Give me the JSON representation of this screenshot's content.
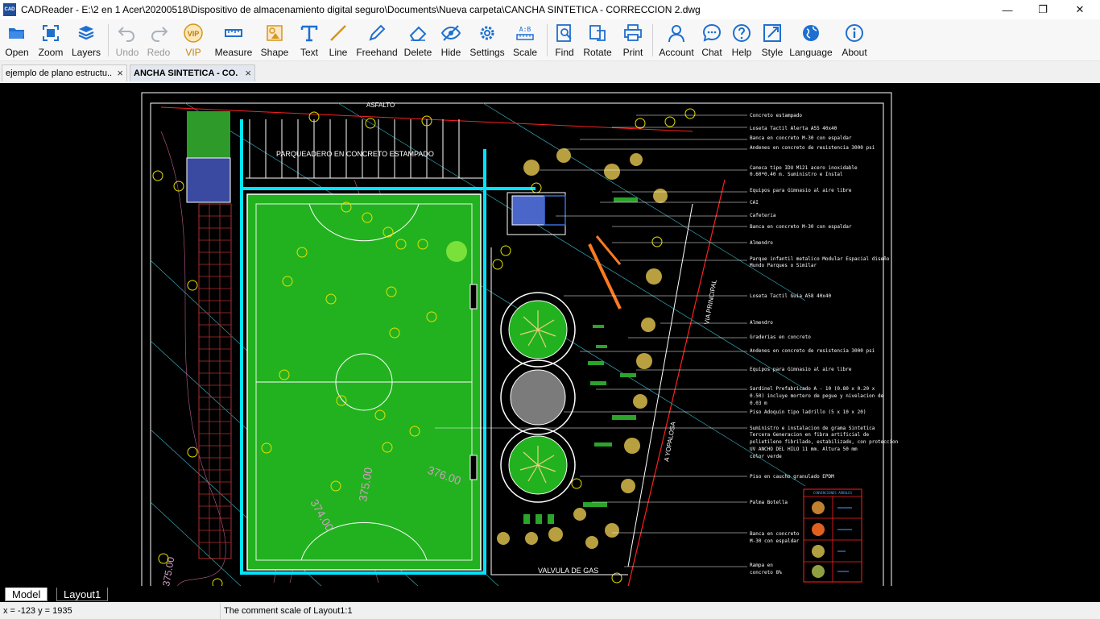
{
  "window": {
    "title": "CADReader - E:\\2 en 1 Acer\\20200518\\Dispositivo de almacenamiento digital seguro\\Documents\\Nueva carpeta\\CANCHA SINTETICA - CORRECCION 2.dwg",
    "app_icon_text": "CAD",
    "minimize": "—",
    "maximize": "❐",
    "close": "✕"
  },
  "toolbar": {
    "open": "Open",
    "zoom": "Zoom",
    "layers": "Layers",
    "undo": "Undo",
    "redo": "Redo",
    "vip": "VIP",
    "measure": "Measure",
    "shape": "Shape",
    "text": "Text",
    "line": "Line",
    "freehand": "Freehand",
    "delete": "Delete",
    "hide": "Hide",
    "settings": "Settings",
    "scale": "Scale",
    "find": "Find",
    "rotate": "Rotate",
    "print": "Print",
    "account": "Account",
    "chat": "Chat",
    "help": "Help",
    "style": "Style",
    "language": "Language",
    "about": "About"
  },
  "tabs": [
    {
      "label": "ejemplo de plano estructu..",
      "close": "×"
    },
    {
      "label": "ANCHA SINTETICA - CO.",
      "close": "×"
    }
  ],
  "drawing": {
    "parking_label": "PARQUEADERO EN CONCRETO ESTAMPADO",
    "top_label": "ASFALTO",
    "contour_376": "376.00",
    "contour_375": "375.00",
    "contour_374": "374.00",
    "contour_375_bl": "375.00",
    "via_principal": "VIA PRINCIPAL",
    "yopalosa": "A YOPALOSA",
    "valvula": "VALVULA DE GAS",
    "legend": [
      "Concreto estampado",
      "Loseta Tactil Alerta A55 40x40",
      "Banca en concreto M-30 con espaldar",
      "Andenes en concreto de resistencia 3000 psi",
      "Caneca tipo IDU M121 acero inoxidable",
      "0.60*0.40 m. Suministro e Instal",
      "Equipos para Gimnasio al aire libre",
      "CAI",
      "Cafeteria",
      "Banca en concreto M-30 con espaldar",
      "Almendro",
      "Parque infantil metalico Modular Espacial diseño",
      "Mundo Parques o Similar",
      "Loseta Tactil Guia A58 40x40",
      "Almendro",
      "Graderias en concreto",
      "Andenes en concreto de resistencia 3000 psi",
      "Equipos para Gimnasio al aire libre",
      "Sardinel Prefabricado A - 10 (0.80 x 0.20 x",
      "0.50) incluye mortero de pegue y nivelacion de",
      "0.03 m",
      "Piso Adoquin tipo ladrillo (5 x 10 x 20)",
      "Suministro e instalacion de grama Sintetica",
      "Tercera Generacion en fibra artificial de",
      "polietileno fibrilado, estabilizado, con proteccion",
      "UV ANCHO DEL HILO 11 mm. Altura 50 mm",
      "color verde",
      "Piso en caucho granulado EPDM",
      "Palma Botella",
      "Banca en concreto",
      "M-30 con espaldar",
      "Rampa en",
      "concreto 8%"
    ],
    "box_title": "CONVENCIONES ARBOLES"
  },
  "layout_tabs": {
    "model": "Model",
    "layout1": "Layout1"
  },
  "status": {
    "coords": "x = -123 y = 1935",
    "note": "The comment scale of Layout1:1"
  },
  "colors": {
    "field_green": "#22b21f",
    "cyan_track": "#00e5ff",
    "drawing_bg": "#000000",
    "toolbar_icon": "#1e6fd0"
  }
}
